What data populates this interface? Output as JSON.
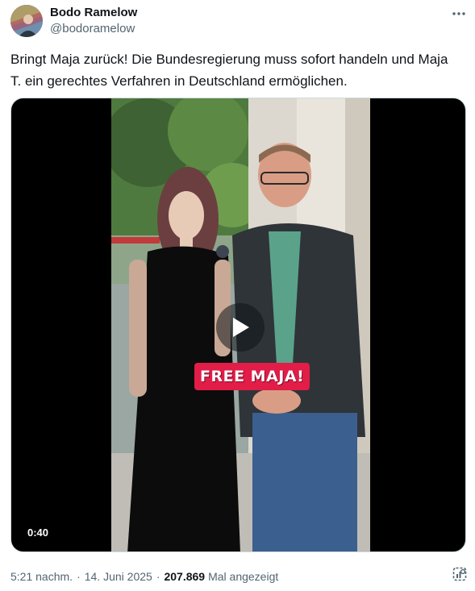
{
  "author": {
    "name": "Bodo Ramelow",
    "handle": "@bodoramelow"
  },
  "tweet": {
    "text": "Bringt Maja zurück! Die Bundesregierung muss sofort handeln und Maja T. ein gerechtes Verfahren in Deutschland ermöglichen."
  },
  "media": {
    "caption": "FREE MAJA!",
    "duration": "0:40",
    "play_icon": "play-icon"
  },
  "meta": {
    "time": "5:21 nachm.",
    "separator": "·",
    "date": "14. Juni 2025",
    "views_count": "207.869",
    "views_label": "Mal angezeigt"
  },
  "icons": {
    "more": "more-horizontal-icon",
    "analytics": "analytics-icon"
  },
  "colors": {
    "text_primary": "#0f1419",
    "text_secondary": "#536471",
    "caption_bg": "#e11d48",
    "media_bg": "#000000"
  }
}
